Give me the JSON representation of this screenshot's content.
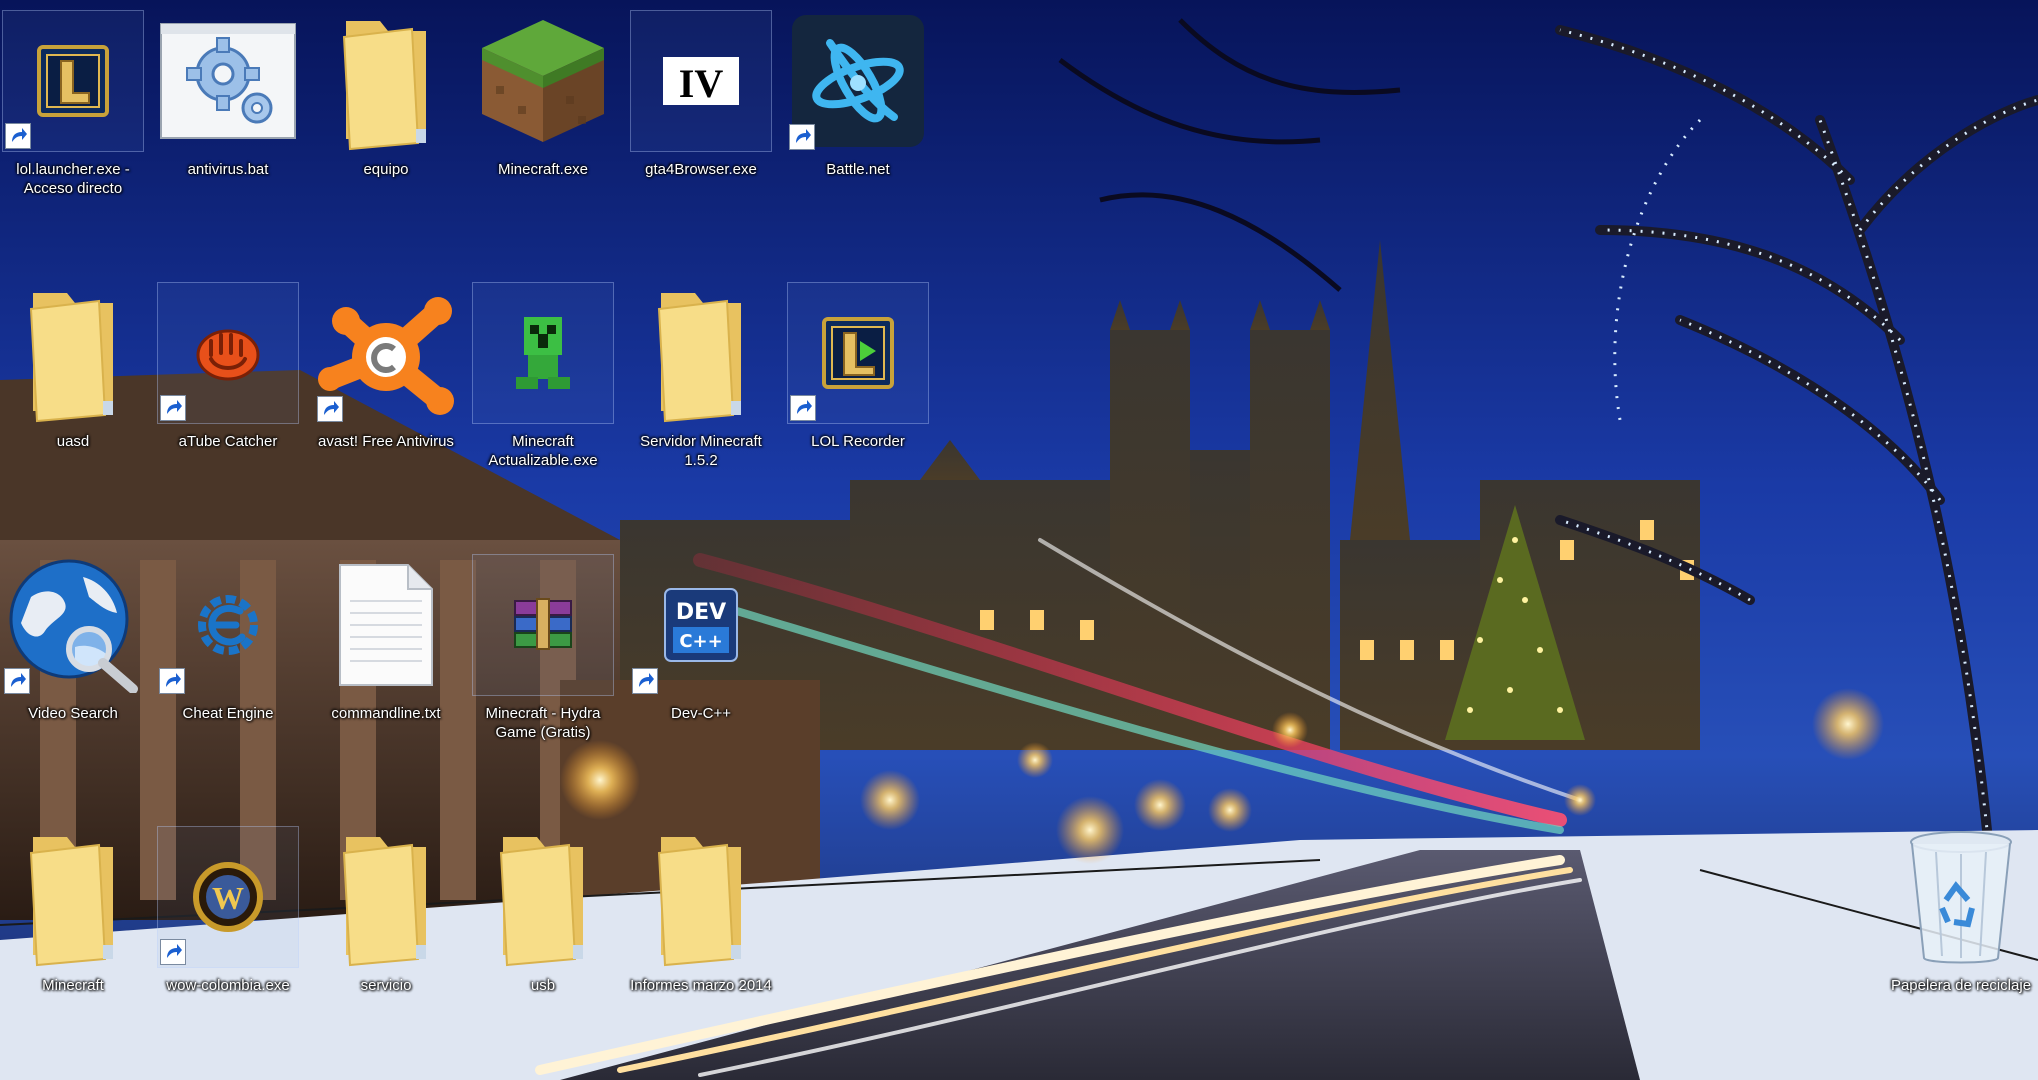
{
  "desktop": {
    "icons": [
      {
        "label": "lol.launcher.exe - Acceso directo",
        "icon": "league-of-legends-icon",
        "shortcut": true
      },
      {
        "label": "antivirus.bat",
        "icon": "batch-file-gear-icon",
        "shortcut": false
      },
      {
        "label": "equipo",
        "icon": "folder-icon",
        "shortcut": false
      },
      {
        "label": "Minecraft.exe",
        "icon": "minecraft-grass-block-icon",
        "shortcut": false
      },
      {
        "label": "gta4Browser.exe",
        "icon": "gta-iv-icon",
        "shortcut": false
      },
      {
        "label": "Battle.net",
        "icon": "battle-net-icon",
        "shortcut": true
      },
      {
        "label": "uasd",
        "icon": "folder-icon",
        "shortcut": false
      },
      {
        "label": "aTube Catcher",
        "icon": "atube-catcher-icon",
        "shortcut": true
      },
      {
        "label": "avast! Free Antivirus",
        "icon": "avast-icon",
        "shortcut": true
      },
      {
        "label": "Minecraft Actualizable.exe",
        "icon": "creeper-icon",
        "shortcut": false
      },
      {
        "label": "Servidor Minecraft 1.5.2",
        "icon": "folder-icon",
        "shortcut": false
      },
      {
        "label": "LOL Recorder",
        "icon": "lol-recorder-icon",
        "shortcut": true
      },
      {
        "label": "Video Search",
        "icon": "globe-search-icon",
        "shortcut": true
      },
      {
        "label": "Cheat Engine",
        "icon": "cheat-engine-icon",
        "shortcut": true
      },
      {
        "label": "commandline.txt",
        "icon": "text-file-icon",
        "shortcut": false
      },
      {
        "label": "Minecraft - Hydra Game (Gratis)",
        "icon": "winrar-archive-icon",
        "shortcut": false
      },
      {
        "label": "Dev-C++",
        "icon": "dev-cpp-icon",
        "shortcut": true
      },
      {
        "label": "Minecraft",
        "icon": "folder-icon",
        "shortcut": false
      },
      {
        "label": "wow-colombia.exe",
        "icon": "world-of-warcraft-icon",
        "shortcut": true
      },
      {
        "label": "servicio",
        "icon": "folder-icon",
        "shortcut": false
      },
      {
        "label": "usb",
        "icon": "folder-icon",
        "shortcut": false
      },
      {
        "label": "Informes marzo 2014",
        "icon": "folder-icon",
        "shortcut": false
      },
      {
        "label": "Papelera de reciclaje",
        "icon": "recycle-bin-icon",
        "shortcut": false
      }
    ]
  },
  "colors": {
    "sky_top": "#0a1a6e",
    "sky_mid": "#1b3ba8",
    "snow": "#e8eef8",
    "warm_light": "#ffc860",
    "folder": "#f3d77a",
    "label_text": "#ffffff"
  }
}
